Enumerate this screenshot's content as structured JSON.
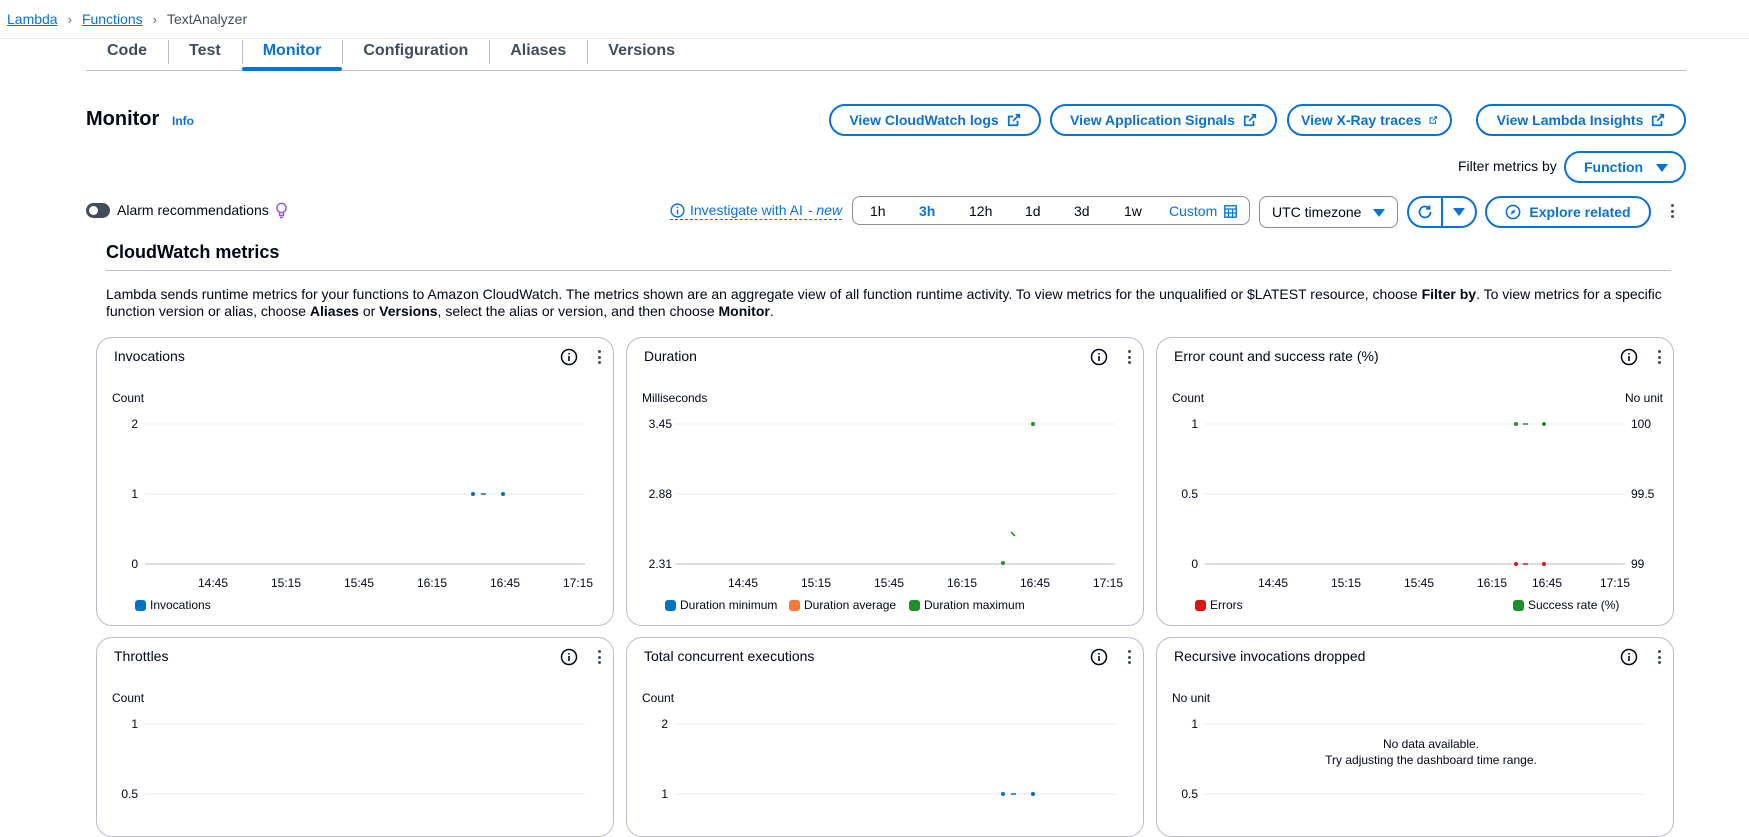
{
  "breadcrumb": {
    "items": [
      "Lambda",
      "Functions"
    ],
    "current": "TextAnalyzer"
  },
  "tabs": [
    "Code",
    "Test",
    "Monitor",
    "Configuration",
    "Aliases",
    "Versions"
  ],
  "monitor": {
    "title": "Monitor",
    "info": "Info"
  },
  "buttons": {
    "cloudwatch_logs": "View CloudWatch logs",
    "app_signals": "View Application Signals",
    "xray": "View X-Ray traces",
    "insights": "View Lambda Insights",
    "explore": "Explore related"
  },
  "filter": {
    "label": "Filter metrics by",
    "value": "Function"
  },
  "alarm": {
    "label": "Alarm recommendations"
  },
  "investigate": {
    "text": "Investigate with AI",
    "suffix": "- new"
  },
  "time_range": {
    "options": [
      "1h",
      "3h",
      "12h",
      "1d",
      "3d",
      "1w"
    ],
    "selected": "3h",
    "custom": "Custom"
  },
  "timezone": "UTC timezone",
  "cloudwatch": {
    "title": "CloudWatch metrics",
    "desc_1": "Lambda sends runtime metrics for your functions to Amazon CloudWatch. The metrics shown are an aggregate view of all function runtime activity. To view metrics for the unqualified or $LATEST resource, choose ",
    "desc_b1": "Filter by",
    "desc_2": ". To view metrics for a specific function version or alias, choose ",
    "desc_b2": "Aliases",
    "desc_3": " or ",
    "desc_b3": "Versions",
    "desc_4": ", select the alias or version, and then choose ",
    "desc_b4": "Monitor",
    "desc_5": "."
  },
  "colors": {
    "blue": "#0972d3",
    "orange": "#f27c36",
    "green": "#1d8f2f",
    "red": "#d91515",
    "series_blue": "#0273bc"
  },
  "cards": {
    "invocations": {
      "title": "Invocations",
      "unit": "Count",
      "legend": [
        "Invocations"
      ]
    },
    "duration": {
      "title": "Duration",
      "unit": "Milliseconds",
      "legend": [
        "Duration minimum",
        "Duration average",
        "Duration maximum"
      ]
    },
    "errors": {
      "title": "Error count and success rate (%)",
      "unit_left": "Count",
      "unit_right": "No unit",
      "legend": [
        "Errors",
        "Success rate (%)"
      ]
    },
    "throttles": {
      "title": "Throttles",
      "unit": "Count"
    },
    "concurrent": {
      "title": "Total concurrent executions",
      "unit": "Count"
    },
    "recursive": {
      "title": "Recursive invocations dropped",
      "unit": "No unit",
      "no_data_1": "No data available.",
      "no_data_2": "Try adjusting the dashboard time range."
    }
  },
  "chart_data": [
    {
      "type": "scatter",
      "title": "Invocations",
      "ylabel": "Count",
      "x_ticks": [
        "14:45",
        "15:15",
        "15:45",
        "16:15",
        "16:45",
        "17:15"
      ],
      "y_ticks": [
        "2",
        "1",
        "0"
      ],
      "ylim": [
        0,
        2
      ],
      "series": [
        {
          "name": "Invocations",
          "color": "#0273bc",
          "points": [
            [
              "16:32",
              1
            ],
            [
              "16:36",
              1
            ],
            [
              "16:44",
              1
            ]
          ]
        }
      ]
    },
    {
      "type": "scatter",
      "title": "Duration",
      "ylabel": "Milliseconds",
      "x_ticks": [
        "14:45",
        "15:15",
        "15:45",
        "16:15",
        "16:45",
        "17:15"
      ],
      "y_ticks": [
        "3.45",
        "2.88",
        "2.31"
      ],
      "ylim": [
        2.31,
        3.45
      ],
      "series": [
        {
          "name": "Duration minimum",
          "color": "#0273bc",
          "points": []
        },
        {
          "name": "Duration average",
          "color": "#f27c36",
          "points": []
        },
        {
          "name": "Duration maximum",
          "color": "#1d8f2f",
          "points": [
            [
              "16:44",
              3.45
            ],
            [
              "16:36",
              2.55
            ],
            [
              "16:32",
              2.31
            ]
          ]
        }
      ]
    },
    {
      "type": "scatter",
      "title": "Error count and success rate (%)",
      "x_ticks": [
        "14:45",
        "15:15",
        "15:45",
        "16:15",
        "16:45",
        "17:15"
      ],
      "y_ticks_left": [
        "1",
        "0.5",
        "0"
      ],
      "y_ticks_right": [
        "100",
        "99.5",
        "99"
      ],
      "series": [
        {
          "name": "Errors",
          "color": "#d91515",
          "points": [
            [
              "16:32",
              0
            ],
            [
              "16:36",
              0
            ],
            [
              "16:44",
              0
            ]
          ]
        },
        {
          "name": "Success rate (%)",
          "color": "#1d8f2f",
          "points": [
            [
              "16:32",
              100
            ],
            [
              "16:36",
              100
            ],
            [
              "16:44",
              100
            ]
          ]
        }
      ]
    },
    {
      "type": "scatter",
      "title": "Throttles",
      "ylabel": "Count",
      "y_ticks": [
        "1",
        "0.5"
      ],
      "series": []
    },
    {
      "type": "scatter",
      "title": "Total concurrent executions",
      "ylabel": "Count",
      "y_ticks": [
        "2",
        "1"
      ],
      "series": [
        {
          "name": "Total concurrent executions",
          "color": "#0273bc",
          "points": [
            [
              "16:32",
              1
            ],
            [
              "16:36",
              1
            ],
            [
              "16:44",
              1
            ]
          ]
        }
      ]
    },
    {
      "type": "scatter",
      "title": "Recursive invocations dropped",
      "ylabel": "No unit",
      "y_ticks": [
        "1",
        "0.5"
      ],
      "series": []
    }
  ]
}
